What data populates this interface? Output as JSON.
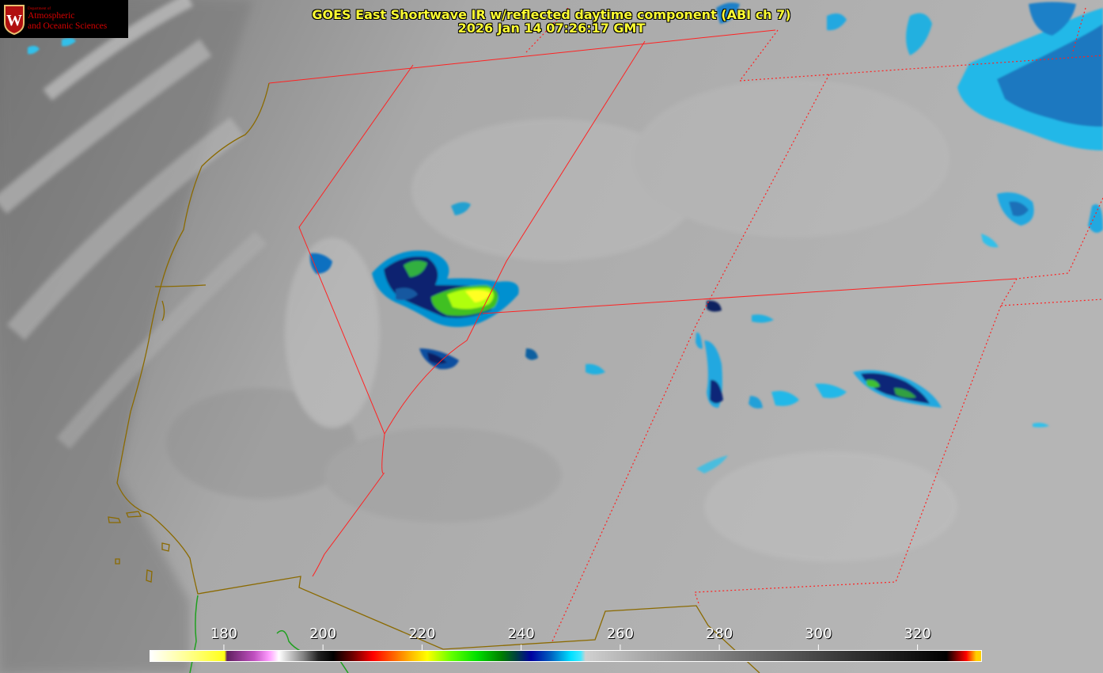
{
  "title": {
    "line1": "GOES East Shortwave IR w/reflected daytime component (ABI ch 7)",
    "line2": "2026 Jan 14 07:26:17 GMT"
  },
  "logo": {
    "department": "Department of",
    "name_line1": "Atmospheric",
    "name_line2": "and Oceanic Sciences",
    "seal_letter": "W"
  },
  "colorbar": {
    "units_min": 165,
    "units_max": 333,
    "tick_labels": [
      "180",
      "200",
      "220",
      "240",
      "260",
      "280",
      "300",
      "320"
    ],
    "tick_values": [
      180,
      200,
      220,
      240,
      260,
      280,
      300,
      320
    ]
  },
  "colors": {
    "title": "#ffff33",
    "state_borders": "#ff2222",
    "coastline": "#8b6a00",
    "logo_red": "#d40000"
  }
}
